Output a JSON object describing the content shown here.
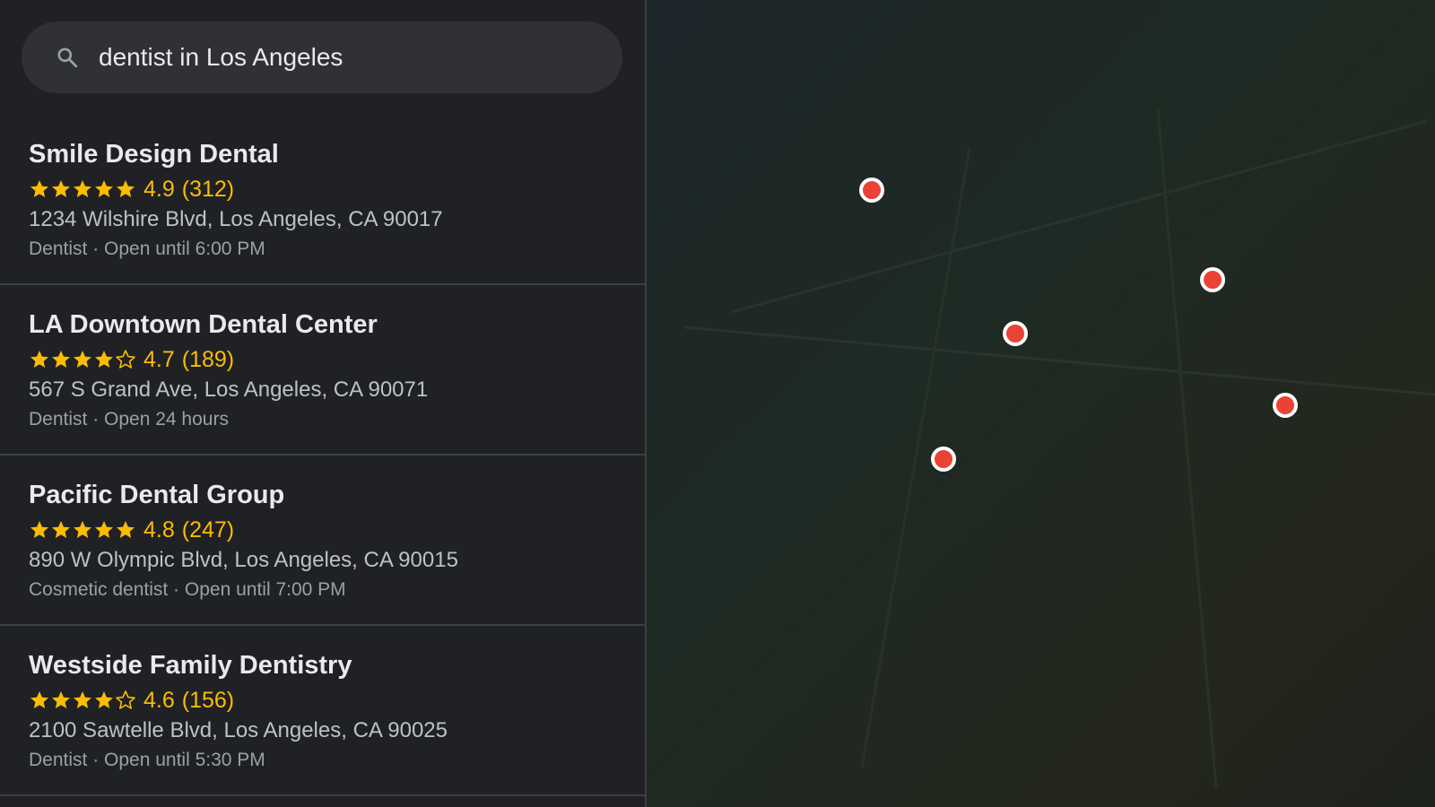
{
  "search": {
    "query": "dentist in Los Angeles",
    "icon": "search-icon"
  },
  "results": [
    {
      "name": "Smile Design Dental",
      "stars": 5,
      "rating": "4.9",
      "reviews": "(312)",
      "address": "1234 Wilshire Blvd, Los Angeles, CA 90017",
      "meta": "Dentist · Open until 6:00 PM"
    },
    {
      "name": "LA Downtown Dental Center",
      "stars": 4,
      "rating": "4.7",
      "reviews": "(189)",
      "address": "567 S Grand Ave, Los Angeles, CA 90071",
      "meta": "Dentist · Open 24 hours"
    },
    {
      "name": "Pacific Dental Group",
      "stars": 5,
      "rating": "4.8",
      "reviews": "(247)",
      "address": "890 W Olympic Blvd, Los Angeles, CA 90015",
      "meta": "Cosmetic dentist · Open until 7:00 PM"
    },
    {
      "name": "Westside Family Dentistry",
      "stars": 4,
      "rating": "4.6",
      "reviews": "(156)",
      "address": "2100 Sawtelle Blvd, Los Angeles, CA 90025",
      "meta": "Dentist · Open until 5:30 PM"
    }
  ],
  "colors": {
    "panel_bg": "#202124",
    "search_bg": "#303134",
    "star": "#fbbc04",
    "pin": "#ea4335"
  }
}
